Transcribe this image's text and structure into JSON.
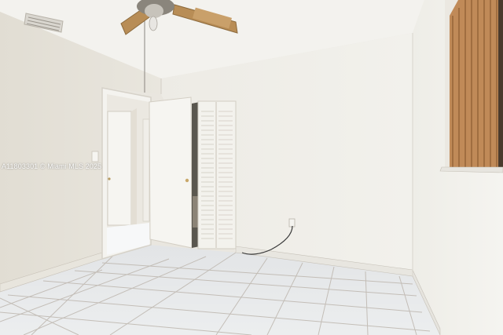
{
  "photo": {
    "subject": "empty bedroom",
    "watermark": "A11803301 © Miami MLS 2025"
  },
  "colors": {
    "left_wall": "#e6e3da",
    "back_wall": "#efede7",
    "right_wall": "#f0efe9",
    "ceiling": "#f3f2ee",
    "floor_tile": "#e4e6e8",
    "grout": "#b9b3ad",
    "blinds": "#b57e4d",
    "fan_blade": "#b88d56"
  },
  "icons": [
    "ceiling-fan-icon",
    "air-vent-icon",
    "closet-door-icon",
    "window-blinds-icon",
    "power-outlet-icon"
  ]
}
